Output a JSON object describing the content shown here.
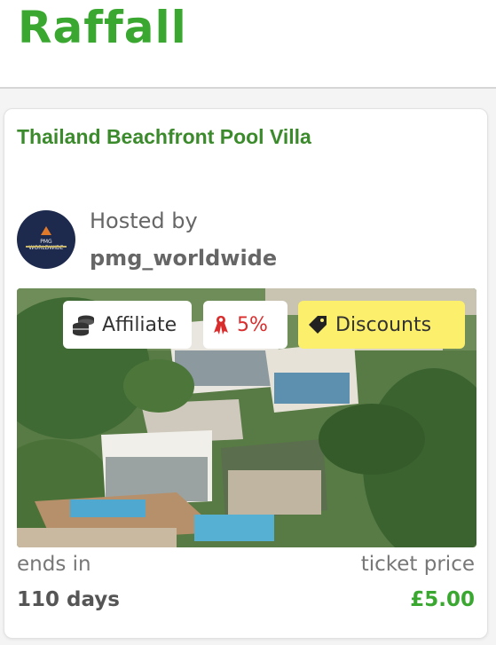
{
  "app": {
    "logo_text": "Raffall"
  },
  "card": {
    "title": "Thailand Beachfront Pool Villa",
    "host": {
      "label": "Hosted by",
      "name": "pmg_worldwide",
      "avatar_text": "PMG WORLDWIDE"
    },
    "tags": {
      "affiliate": "Affiliate",
      "commission": "5%",
      "discounts": "Discounts"
    },
    "ends": {
      "label": "ends in",
      "value": "110 days"
    },
    "price": {
      "label": "ticket price",
      "value": "£5.00"
    }
  },
  "colors": {
    "brand": "#3aa830",
    "title": "#3b8a2b",
    "discount_bg": "#fbef6b",
    "commission": "#d92c2c"
  },
  "icons": [
    "coins-stack-icon",
    "ribbon-icon",
    "tag-icon"
  ]
}
